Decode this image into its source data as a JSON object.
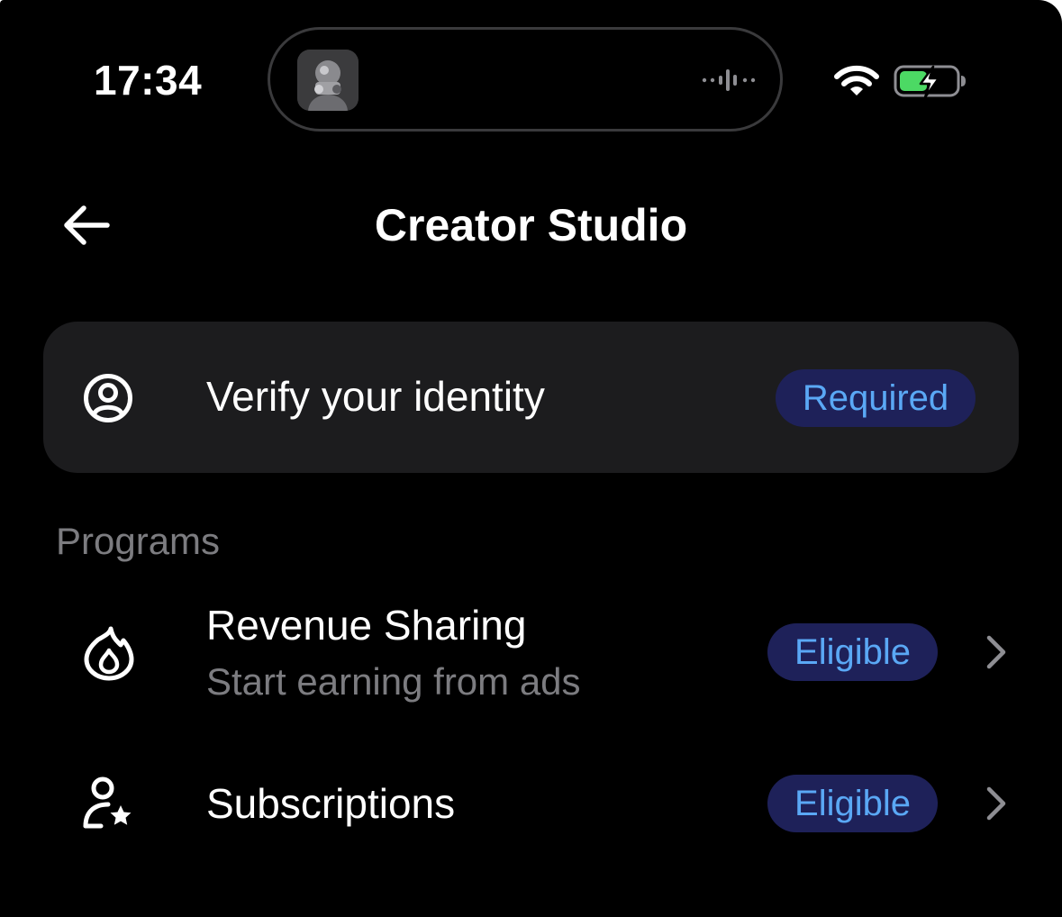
{
  "status_bar": {
    "time": "17:34",
    "wifi_icon": "wifi-icon",
    "battery_icon": "battery-charging-icon",
    "battery_color": "#4cd964"
  },
  "header": {
    "back_icon": "arrow-left-icon",
    "title": "Creator Studio"
  },
  "verify": {
    "icon": "user-circle-icon",
    "label": "Verify your identity",
    "badge": "Required"
  },
  "programs": {
    "section_label": "Programs",
    "items": [
      {
        "icon": "flame-icon",
        "title": "Revenue Sharing",
        "subtitle": "Start earning from ads",
        "badge": "Eligible",
        "chevron": "chevron-right-icon"
      },
      {
        "icon": "user-star-icon",
        "title": "Subscriptions",
        "badge": "Eligible",
        "chevron": "chevron-right-icon"
      }
    ]
  },
  "colors": {
    "background": "#000000",
    "card": "#1c1c1e",
    "badge_bg": "#1e2159",
    "badge_text": "#5aa8f5",
    "secondary_text": "#7c7c80"
  }
}
